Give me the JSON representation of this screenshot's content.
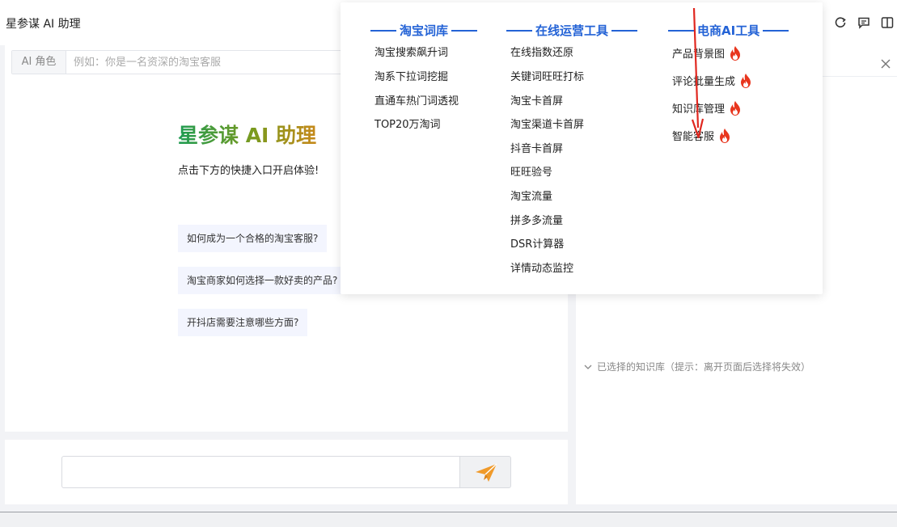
{
  "app": {
    "title": "星参谋 AI 助理"
  },
  "toolbar": {
    "icons": [
      "refresh-icon",
      "chat-icon",
      "split-view-icon"
    ]
  },
  "role": {
    "label": "AI 角色",
    "placeholder": "例如：你是一名资深的淘宝客服"
  },
  "welcome": {
    "title": "星参谋 AI 助理",
    "subtitle": "点击下方的快捷入口开启体验!"
  },
  "suggestions": [
    "如何成为一个合格的淘宝客服?",
    "淘宝商家如何选择一款好卖的产品?",
    "开抖店需要注意哪些方面?"
  ],
  "chat": {
    "input_value": "",
    "send_icon": "paper-plane-icon"
  },
  "knowledge": {
    "selected_text": "已选择的知识库（提示：离开页面后选择将失效）"
  },
  "menu": {
    "columns": [
      {
        "title": "淘宝词库",
        "items": [
          "淘宝搜索飙升词",
          "淘系下拉词挖掘",
          "直通车热门词透视",
          "TOP20万淘词"
        ]
      },
      {
        "title": "在线运营工具",
        "items": [
          "在线指数还原",
          "关键词旺旺打标",
          "淘宝卡首屏",
          "淘宝渠道卡首屏",
          "抖音卡首屏",
          "旺旺验号",
          "淘宝流量",
          "拼多多流量",
          "DSR计算器",
          "详情动态监控"
        ]
      },
      {
        "title": "电商AI工具",
        "items": [
          "产品背景图",
          "评论批量生成",
          "知识库管理",
          "智能客服"
        ],
        "badge_icon": "fire-icon"
      }
    ]
  },
  "colors": {
    "menu_heading": "#2463d6",
    "annotation_arrow": "#e0271f",
    "fire": "#e8361e",
    "send_icon": "#f09a2a",
    "suggestion_bg": "#f3f5fe"
  }
}
